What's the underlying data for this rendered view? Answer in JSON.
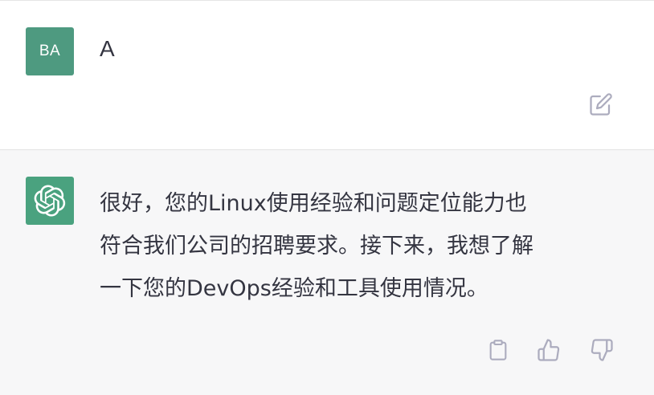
{
  "user_message": {
    "avatar_initials": "BA",
    "text": "A",
    "edit_icon": "pencil-square-icon"
  },
  "assistant_message": {
    "avatar_icon": "openai-logo-icon",
    "lines": [
      "很好，您的Linux使用经验和问题定位能力也",
      "符合我们公司的招聘要求。接下来，我想了解",
      "一下您的DevOps经验和工具使用情况。"
    ],
    "actions": [
      "clipboard-icon",
      "thumbs-up-icon",
      "thumbs-down-icon"
    ]
  },
  "colors": {
    "user_avatar_bg": "#4e9a80",
    "assistant_avatar_bg": "#4aa27f",
    "assistant_bg": "#f7f7f8",
    "text": "#343541",
    "icon_gray": "#acacbe"
  }
}
